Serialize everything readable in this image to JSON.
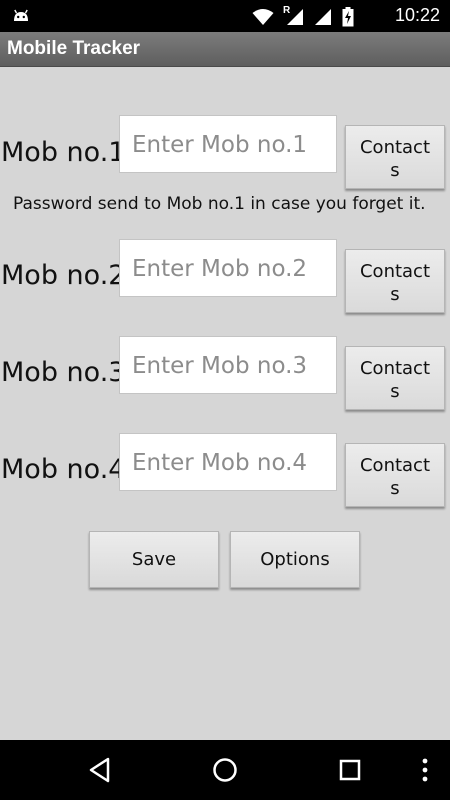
{
  "status_bar": {
    "time": "10:22",
    "icons": [
      "android-icon",
      "wifi-icon",
      "signal-roaming-icon",
      "signal-icon",
      "battery-charging-icon"
    ],
    "roaming_letter": "R"
  },
  "app_bar": {
    "title": "Mobile Tracker"
  },
  "form": {
    "rows": [
      {
        "label": "Mob no.1",
        "placeholder": "Enter Mob no.1",
        "value": "",
        "contacts_label": "Contact\ns"
      },
      {
        "label": "Mob no.2",
        "placeholder": "Enter Mob no.2",
        "value": "",
        "contacts_label": "Contact\ns"
      },
      {
        "label": "Mob no.3",
        "placeholder": "Enter Mob no.3",
        "value": "",
        "contacts_label": "Contact\ns"
      },
      {
        "label": "Mob no.4",
        "placeholder": "Enter Mob no.4",
        "value": "",
        "contacts_label": "Contact\ns"
      }
    ],
    "hint": "Password send to Mob no.1 in case you forget it."
  },
  "actions": {
    "save_label": "Save",
    "options_label": "Options"
  },
  "nav_bar": {
    "icons": [
      "back-icon",
      "home-icon",
      "recents-icon",
      "more-options-icon"
    ]
  },
  "colors": {
    "background": "#d6d6d6",
    "app_bar": "#6b6b6b",
    "status_bar": "#000000",
    "input_bg": "#ffffff"
  }
}
